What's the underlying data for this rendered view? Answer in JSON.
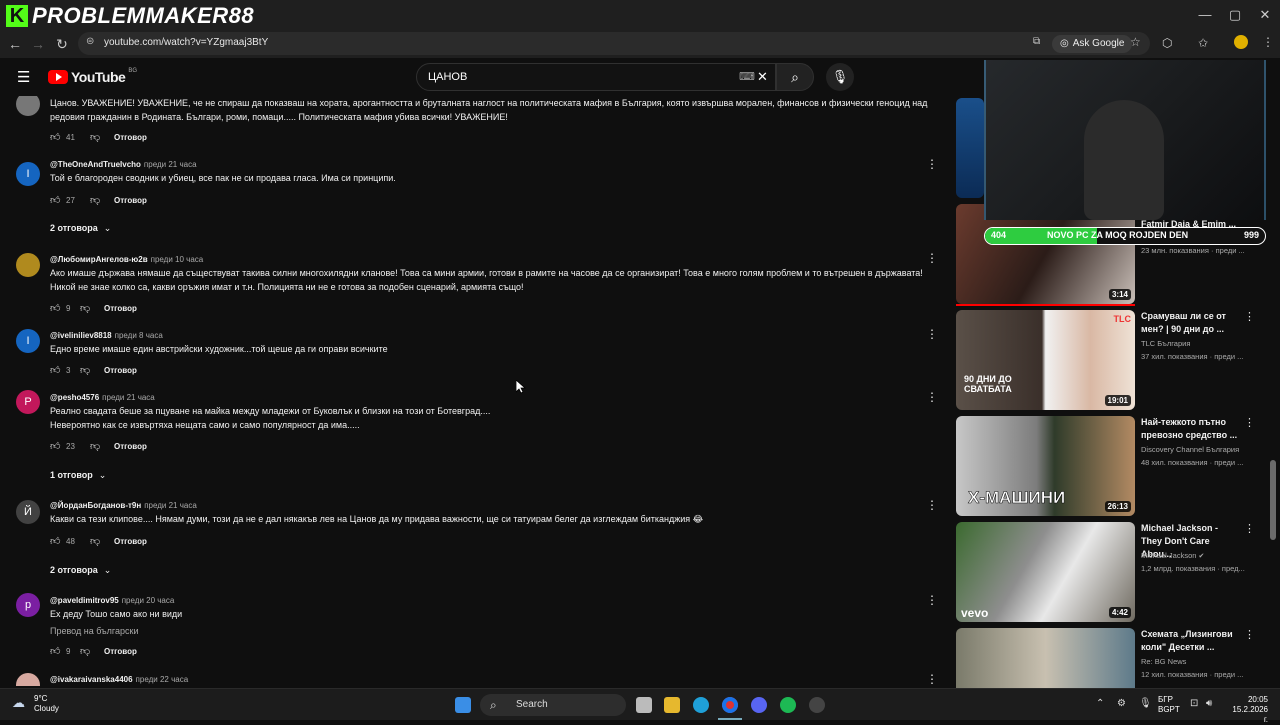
{
  "browser": {
    "channel_overlay_name": "PROBLEMMAKER88",
    "url": "youtube.com/watch?v=YZgmaaj3BtY",
    "ask_google": "Ask Google"
  },
  "youtube": {
    "logo_text": "YouTube",
    "country_code": "BG",
    "search_value": "ЦАНОВ"
  },
  "comments": [
    {
      "handle": "",
      "time": "",
      "text": "Цанов. УВАЖЕНИЕ! УВАЖЕНИЕ, че не спираш да показваш на хората, арогантността и бруталната наглост на политическата мафия в България, която извършва морален, финансов и физически геноцид над редовия гражданин в Родината. Българи, роми, помаци.....  Политическата мафия убива всички! УВАЖЕНИЕ!",
      "likes": "41",
      "reply_label": "Отговор"
    },
    {
      "handle": "@TheOneAndTrueIvcho",
      "time": "преди 21 часа",
      "avatar_letter": "I",
      "text": "Той е благороден сводник и убиец, все пак не си продава гласа. Има си принципи.",
      "likes": "27",
      "reply_label": "Отговор",
      "replies": "2 отговора"
    },
    {
      "handle": "@ЛюбомирАнгелов-ю2в",
      "time": "преди 10 часа",
      "text": "Ако имаше държава нямаше да съществуват такива силни многохилядни кланове! Това са мини армии, готови в рамите на часове да се организират! Това е много голям проблем и то вътрешен в държавата! Никой не знае колко са, какви оръжия имат и т.н. Полицията ни не е готова за подобен сценарий, армията също!",
      "likes": "9",
      "reply_label": "Отговор"
    },
    {
      "handle": "@iveliniliev8818",
      "time": "преди 8 часа",
      "avatar_letter": "I",
      "text": "Едно време имаше един австрийски художник...той щеше да ги оправи всичките",
      "likes": "3",
      "reply_label": "Отговор"
    },
    {
      "handle": "@pesho4576",
      "time": "преди 21 часа",
      "avatar_letter": "P",
      "text_line1": "Реално свадата беше за пцуване на майка между младежи от Буковлък  и близки на този от Ботевград....",
      "text_line2": "Невероятно как се извъртяха нещата само и само популярност да има.....",
      "likes": "23",
      "reply_label": "Отговор",
      "replies": "1 отговор"
    },
    {
      "handle": "@ЙорданБогданов-т9н",
      "time": "преди 21 часа",
      "avatar_letter": "Й",
      "text": "Какви са тези клипове.... Нямам думи, този да не е дал някакъв лев на Цанов да му придава важности, ще си татуирам белег да изглеждам битканджия 😂",
      "likes": "48",
      "reply_label": "Отговор",
      "replies": "2 отговора"
    },
    {
      "handle": "@paveldimitrov95",
      "time": "преди 20 часа",
      "avatar_letter": "p",
      "text": "Ех деду Тошо само ако ни види",
      "translate": "Превод на български",
      "likes": "9",
      "reply_label": "Отговор"
    },
    {
      "handle": "@ivakaraivanska4406",
      "time": "преди 22 часа"
    }
  ],
  "webcam": {
    "goal_current": "404",
    "goal_text": "NOVO PC ZA MOQ ROJDEN DEN",
    "goal_target": "999",
    "goal_progress": 0.4
  },
  "related_videos": [
    {
      "title": "Fatmir Daja & Emim ...",
      "meta": "23 млн. показвания · преди ...",
      "duration": "3:14"
    },
    {
      "title": "Срамуваш ли се от мен? | 90 дни до ...",
      "channel": "TLC България",
      "meta": "37 хил. показвания · преди ...",
      "duration": "19:01",
      "thumb_text": "90 ДНИ ДО СВАТБАТА",
      "badge": "TLC"
    },
    {
      "title": "Най-тежкото пътно превозно средство ...",
      "channel": "Discovery Channel България",
      "meta": "48 хил. показвания · преди ...",
      "duration": "26:13",
      "thumb_text": "Х-МАШИНИ"
    },
    {
      "title": "Michael Jackson - They Don't Care Abou...",
      "channel": "Michael Jackson",
      "meta": "1,2 млрд. показвания · пред...",
      "duration": "4:42",
      "thumb_text": "vevo"
    },
    {
      "title": "Схемата „Лизингови коли\" Десетки ...",
      "channel": "Re: BG News",
      "meta": "12 хил. показвания · преди ..."
    }
  ],
  "taskbar": {
    "temp": "9°C",
    "weather": "Cloudy",
    "search": "Search",
    "lang1": "БГР",
    "lang2": "BGPT",
    "time": "20:05",
    "date": "15.2.2026 г."
  }
}
